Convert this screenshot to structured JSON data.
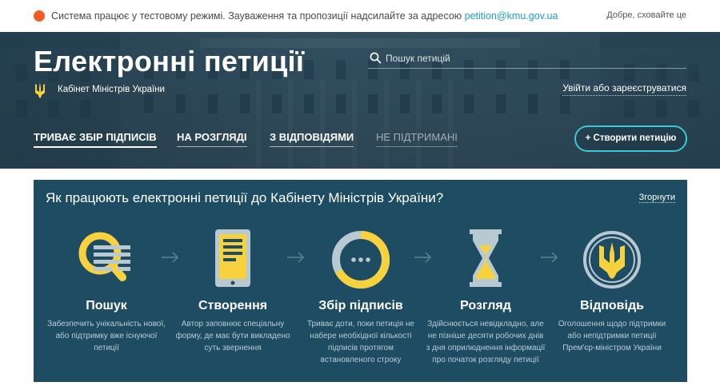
{
  "notice": {
    "text": "Система працює у тестовому режимі. Зауваження та пропозиції надсилайте за адресою ",
    "email": "petition@kmu.gov.ua",
    "hide_label": "Добре, сховайте це"
  },
  "header": {
    "title": "Електронні петиції",
    "subtitle": "Кабінет Міністрів України",
    "search_placeholder": "Пошук петицій",
    "login_label": "Увійти або зареєструватися",
    "create_label": "+ Створити петицію",
    "tabs": [
      {
        "label": "ТРИВАЄ ЗБІР ПІДПИСІВ"
      },
      {
        "label": "НА РОЗГЛЯДІ"
      },
      {
        "label": "З ВІДПОВІДЯМИ"
      },
      {
        "label": "НЕ ПІДТРИМАНІ"
      }
    ]
  },
  "how": {
    "title": "Як працюють електронні петиції до Кабінету Міністрів України?",
    "collapse_label": "Згорнути",
    "steps": [
      {
        "name": "Пошук",
        "desc": "Забезпечить унікальність нової, або підтримку вже існуючої петиції",
        "icon": "magnifier-icon"
      },
      {
        "name": "Створення",
        "desc": "Автор заповнює спеціальну форму, де має бути викладено суть звернення",
        "icon": "tablet-form-icon"
      },
      {
        "name": "Збір підписів",
        "desc": "Триває доти, поки петиція не набере необхідної кількості підписів протягом встановленого строку",
        "icon": "progress-ring-icon"
      },
      {
        "name": "Розгляд",
        "desc": "Здійснюється невідкладно, але не пізніше десяти робочих днів з дня оприлюднення інформації про початок розгляду петиції",
        "icon": "hourglass-icon"
      },
      {
        "name": "Відповідь",
        "desc": "Оголошення щодо підтримки або непідтримки петиції Прем'єр-міністром України",
        "icon": "trident-seal-icon"
      }
    ]
  },
  "colors": {
    "accent_yellow": "#f7d23e",
    "accent_cyan": "#3ec7d6",
    "panel_bg": "#1e4d63",
    "notice_dot": "#f45a26"
  }
}
